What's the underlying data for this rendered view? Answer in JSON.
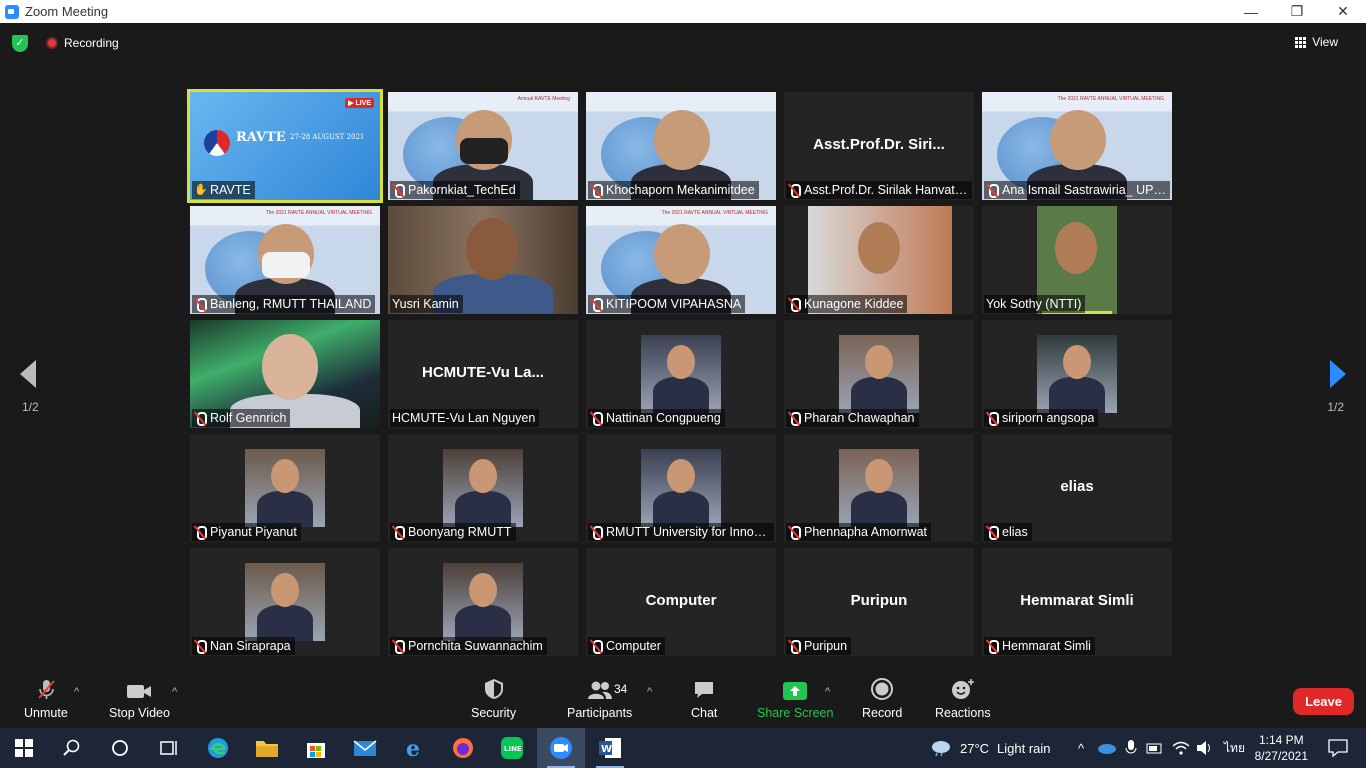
{
  "window": {
    "title": "Zoom Meeting",
    "minimize": "—",
    "maximize": "❐",
    "close": "✕"
  },
  "topbar": {
    "recording_label": "Recording",
    "view_label": "View"
  },
  "gallery": {
    "page_left": "1/2",
    "page_right": "1/2",
    "tiles": [
      {
        "name": "RAVTE",
        "muted": false,
        "kind": "live",
        "live_badge": "LIVE",
        "slide_title": "RAVTE",
        "slide_date": "27-28 AUGUST 2021"
      },
      {
        "name": "Pakornkiat_TechEd",
        "muted": true,
        "kind": "slide-person",
        "slide_header": "Annual RAVTE Meeting"
      },
      {
        "name": "Khochaporn Mekanimitdee",
        "muted": true,
        "kind": "slide-person",
        "slide_header": ""
      },
      {
        "name": "Asst.Prof.Dr. Sirilak Hanvatananukul",
        "bigname": "Asst.Prof.Dr.  Siri...",
        "muted": true,
        "kind": "name"
      },
      {
        "name": "Ana Ismail Sastrawiria_ UPI Indonesia",
        "muted": true,
        "kind": "slide-person",
        "slide_header": "The 2021 RAVTE ANNUAL VIRTUAL MEETING"
      },
      {
        "name": "Banleng, RMUTT THAILAND",
        "muted": true,
        "kind": "slide-person",
        "slide_header": "The 2021 RAVTE ANNUAL VIRTUAL MEETING"
      },
      {
        "name": "Yusri Kamin",
        "muted": false,
        "kind": "camera"
      },
      {
        "name": "KITIPOOM VIPAHASNA",
        "muted": true,
        "kind": "slide-person",
        "slide_header": "The 2021 RAVTE ANNUAL VIRTUAL MEETING"
      },
      {
        "name": "Kunagone Kiddee",
        "muted": true,
        "kind": "camera-small"
      },
      {
        "name": "Yok Sothy (NTTI)",
        "muted": false,
        "kind": "camera-small",
        "speaking": true
      },
      {
        "name": "Rolf Gennrich",
        "muted": true,
        "kind": "aurora"
      },
      {
        "name": "HCMUTE-Vu Lan Nguyen",
        "bigname": "HCMUTE-Vu  La...",
        "muted": false,
        "kind": "name"
      },
      {
        "name": "Nattinan Congpueng",
        "muted": true,
        "kind": "photo"
      },
      {
        "name": "Pharan Chawaphan",
        "muted": true,
        "kind": "photo"
      },
      {
        "name": "siriporn angsopa",
        "muted": true,
        "kind": "photo"
      },
      {
        "name": "Piyanut Piyanut",
        "muted": true,
        "kind": "photo"
      },
      {
        "name": "Boonyang RMUTT",
        "muted": true,
        "kind": "photo"
      },
      {
        "name": "RMUTT University for Innovation",
        "muted": true,
        "kind": "photo"
      },
      {
        "name": "Phennapha Amornwat",
        "muted": true,
        "kind": "photo"
      },
      {
        "name": "elias",
        "bigname": "elias",
        "muted": true,
        "kind": "name"
      },
      {
        "name": "Nan Siraprapa",
        "muted": true,
        "kind": "photo"
      },
      {
        "name": "Pornchita Suwannachim",
        "muted": true,
        "kind": "photo"
      },
      {
        "name": "Computer",
        "bigname": "Computer",
        "muted": true,
        "kind": "name"
      },
      {
        "name": "Puripun",
        "bigname": "Puripun",
        "muted": true,
        "kind": "name"
      },
      {
        "name": "Hemmarat Simli",
        "bigname": "Hemmarat Simli",
        "muted": true,
        "kind": "name"
      }
    ]
  },
  "controls": {
    "unmute": "Unmute",
    "stop_video": "Stop Video",
    "security": "Security",
    "participants": "Participants",
    "participants_count": "34",
    "chat": "Chat",
    "share_screen": "Share Screen",
    "record": "Record",
    "reactions": "Reactions",
    "leave": "Leave"
  },
  "taskbar": {
    "weather_temp": "27°C",
    "weather_text": "Light rain",
    "language": "ไทย",
    "time": "1:14 PM",
    "date": "8/27/2021"
  },
  "colors": {
    "accent": "#2d8cff",
    "leave": "#e02828",
    "share": "#23c552",
    "active_speaker": "#d6e13c"
  }
}
